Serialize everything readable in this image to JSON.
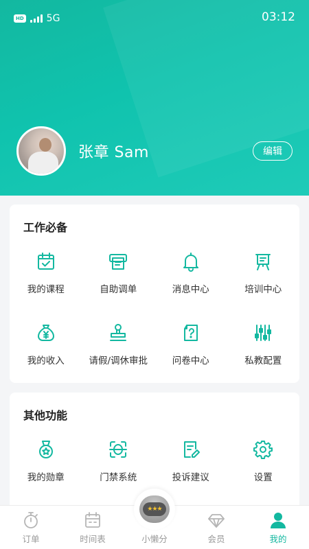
{
  "status_bar": {
    "hd": "HD",
    "network": "5G",
    "time": "03:12"
  },
  "profile": {
    "name": "张章 Sam",
    "edit_label": "编辑"
  },
  "work_section": {
    "title": "工作必备",
    "items": [
      {
        "label": "我的课程",
        "icon": "calendar-check-icon"
      },
      {
        "label": "自助调单",
        "icon": "printer-receipt-icon"
      },
      {
        "label": "消息中心",
        "icon": "bell-icon"
      },
      {
        "label": "培训中心",
        "icon": "easel-board-icon"
      },
      {
        "label": "我的收入",
        "icon": "money-bag-icon"
      },
      {
        "label": "请假/调休审批",
        "icon": "stamp-icon"
      },
      {
        "label": "问卷中心",
        "icon": "question-document-icon"
      },
      {
        "label": "私教配置",
        "icon": "sliders-icon"
      }
    ]
  },
  "other_section": {
    "title": "其他功能",
    "items": [
      {
        "label": "我的勋章",
        "icon": "medal-icon"
      },
      {
        "label": "门禁系统",
        "icon": "face-scan-icon"
      },
      {
        "label": "投诉建议",
        "icon": "edit-note-icon"
      },
      {
        "label": "设置",
        "icon": "gear-icon"
      }
    ]
  },
  "tabbar": {
    "items": [
      {
        "label": "订单",
        "icon": "stopwatch-icon",
        "active": false
      },
      {
        "label": "时间表",
        "icon": "calendar-icon",
        "active": false
      },
      {
        "label": "小懒分",
        "icon": "robot-icon",
        "active": false
      },
      {
        "label": "会员",
        "icon": "diamond-icon",
        "active": false
      },
      {
        "label": "我的",
        "icon": "person-icon",
        "active": true
      }
    ]
  },
  "colors": {
    "accent": "#13b8a0",
    "inactive": "#999999",
    "background": "#f4f5f7"
  }
}
